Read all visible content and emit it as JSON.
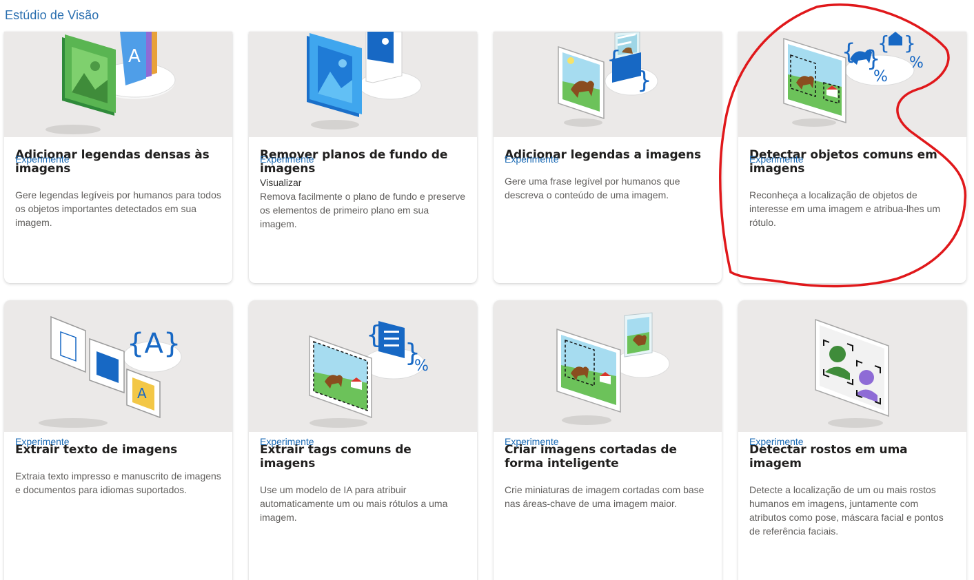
{
  "app": {
    "title": "Estúdio de Visão"
  },
  "cards": [
    {
      "title": "Adicionar legendas densas às imagens",
      "subtitle": "",
      "description": "Gere legendas legíveis por humanos para todos os objetos importantes detectados em sua imagem.",
      "link": "Experimente",
      "illustration": "dense-captions-illustration"
    },
    {
      "title": "Remover planos de fundo de imagens",
      "subtitle": "Visualizar",
      "description": "Remova facilmente o plano de fundo e preserve os elementos de primeiro plano em sua imagem.",
      "link": "Experimente",
      "illustration": "background-removal-illustration"
    },
    {
      "title": "Adicionar legendas a imagens",
      "subtitle": "",
      "description": "Gere uma frase legível por humanos que descreva o conteúdo de uma imagem.",
      "link": "Experimente",
      "illustration": "image-caption-illustration"
    },
    {
      "title": "Detectar objetos comuns em imagens",
      "subtitle": "",
      "description": "Reconheça a localização de objetos de interesse em uma imagem e atribua-lhes um rótulo.",
      "link": "Experimente",
      "illustration": "object-detection-illustration"
    },
    {
      "title": "Extrair texto de imagens",
      "subtitle": "",
      "description": "Extraia texto impresso e manuscrito de imagens e documentos para idiomas suportados.",
      "link": "Experimente",
      "illustration": "ocr-illustration"
    },
    {
      "title": "Extrair tags comuns de imagens",
      "subtitle": "",
      "description": "Use um modelo de IA para atribuir automaticamente um ou mais rótulos a uma imagem.",
      "link": "Experimente",
      "illustration": "tagging-illustration"
    },
    {
      "title": "Criar imagens cortadas de forma inteligente",
      "subtitle": "",
      "description": "Crie miniaturas de imagem cortadas com base nas áreas-chave de uma imagem maior.",
      "link": "Experimente",
      "illustration": "smart-crop-illustration"
    },
    {
      "title": "Detectar rostos em uma imagem",
      "subtitle": "",
      "description": "Detecte a localização de um ou mais rostos humanos em imagens, juntamente com atributos como pose, máscara facial e pontos de referência faciais.",
      "link": "Experimente",
      "illustration": "face-detection-illustration"
    }
  ],
  "annotation": {
    "type": "hand-drawn-circle",
    "color": "#e0181b",
    "target": "Detectar objetos comuns em imagens"
  }
}
